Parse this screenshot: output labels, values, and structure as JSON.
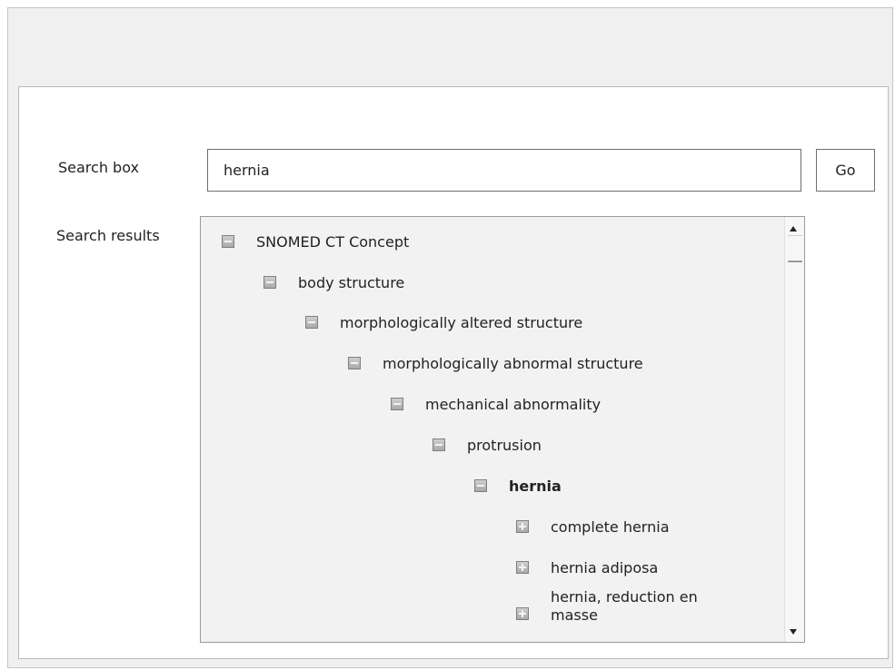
{
  "form": {
    "search_label": "Search box",
    "search_value": "hernia",
    "go_label": "Go",
    "results_label": "Search results"
  },
  "tree": [
    {
      "label": "SNOMED CT Concept",
      "icon": "collapse-icon",
      "level": 0
    },
    {
      "label": "body structure",
      "icon": "collapse-icon",
      "level": 1
    },
    {
      "label": "morphologically altered structure",
      "icon": "collapse-icon",
      "level": 2
    },
    {
      "label": "morphologically abnormal structure",
      "icon": "collapse-icon",
      "level": 3
    },
    {
      "label": "mechanical abnormality",
      "icon": "collapse-icon",
      "level": 4
    },
    {
      "label": "protrusion",
      "icon": "collapse-icon",
      "level": 5
    },
    {
      "label": "hernia",
      "icon": "collapse-icon",
      "level": 6,
      "selected": true
    },
    {
      "label": "complete hernia",
      "icon": "expand-icon",
      "level": 7
    },
    {
      "label": "hernia adiposa",
      "icon": "expand-icon",
      "level": 7
    },
    {
      "label": "hernia, reduction en masse",
      "icon": "expand-icon",
      "level": 7
    }
  ],
  "colors": {
    "frame_bg": "#f0f0f0",
    "results_bg": "#f2f2f2",
    "border": "#6e6e6e"
  }
}
